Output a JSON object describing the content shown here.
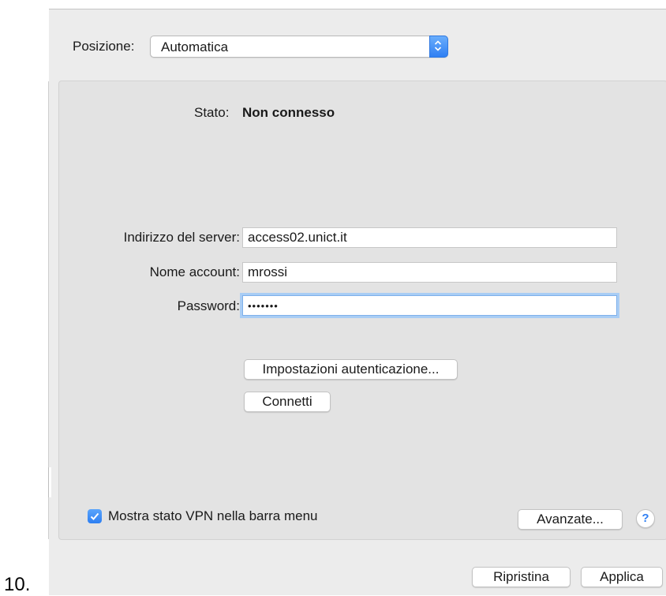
{
  "step_number": "10.",
  "location": {
    "label": "Posizione:",
    "value": "Automatica"
  },
  "status": {
    "label": "Stato:",
    "value": "Non connesso"
  },
  "form": {
    "server_label": "Indirizzo del server:",
    "server_value": "access02.unict.it",
    "account_label": "Nome account:",
    "account_value": "mrossi",
    "password_label": "Password:",
    "password_value": "•••••••"
  },
  "buttons": {
    "auth_settings": "Impostazioni autenticazione...",
    "connect": "Connetti",
    "advanced": "Avanzate...",
    "help": "?",
    "revert": "Ripristina",
    "apply": "Applica"
  },
  "show_vpn_status": {
    "label": "Mostra stato VPN nella barra menu",
    "checked": true
  },
  "colors": {
    "accent": "#2f7ff3",
    "focus_ring": "#a9cdf5",
    "panel": "#e3e3e3"
  }
}
